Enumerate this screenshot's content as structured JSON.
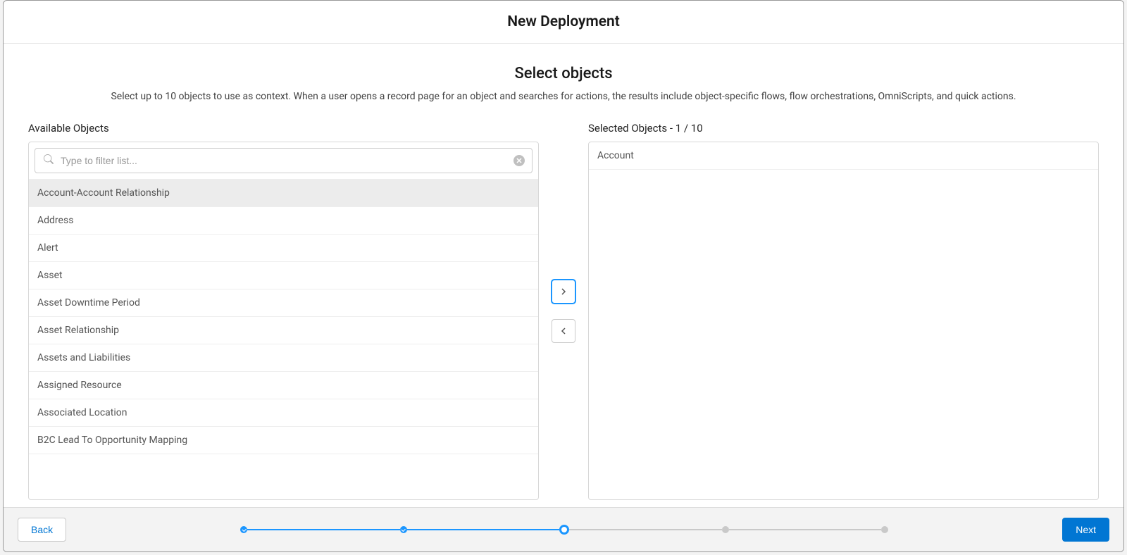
{
  "modal": {
    "title": "New Deployment"
  },
  "section": {
    "title": "Select objects",
    "description": "Select up to 10 objects to use as context. When a user opens a record page for an object and searches for actions, the results include object-specific flows, flow orchestrations, OmniScripts, and quick actions."
  },
  "available": {
    "label": "Available Objects",
    "search_placeholder": "Type to filter list...",
    "items": [
      "Account-Account Relationship",
      "Address",
      "Alert",
      "Asset",
      "Asset Downtime Period",
      "Asset Relationship",
      "Assets and Liabilities",
      "Assigned Resource",
      "Associated Location",
      "B2C Lead To Opportunity Mapping"
    ]
  },
  "selected": {
    "label": "Selected Objects - 1 / 10",
    "items": [
      "Account"
    ]
  },
  "footer": {
    "back": "Back",
    "next": "Next"
  },
  "progress": {
    "steps": 5,
    "current": 3
  }
}
